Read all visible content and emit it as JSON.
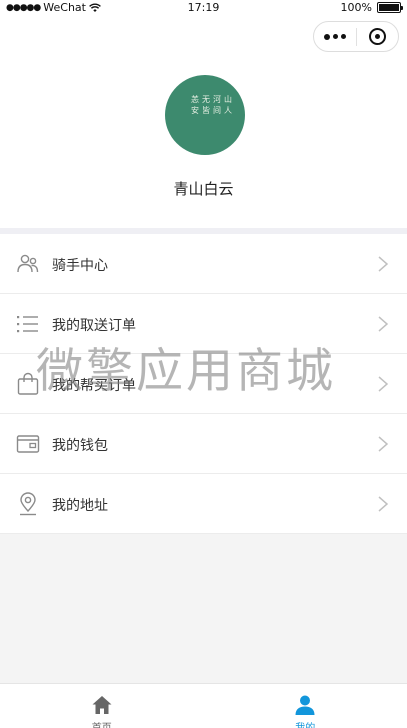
{
  "status_bar": {
    "carrier": "WeChat",
    "time": "17:19",
    "battery": "100%"
  },
  "profile": {
    "nickname": "青山白云",
    "avatar_text": [
      "山",
      "河",
      "无",
      "恙",
      "人",
      "间",
      "皆",
      "安"
    ]
  },
  "menu": {
    "items": [
      {
        "label": "骑手中心",
        "icon": "rider-icon"
      },
      {
        "label": "我的取送订单",
        "icon": "list-icon"
      },
      {
        "label": "我的帮买订单",
        "icon": "shopping-bag-icon"
      },
      {
        "label": "我的钱包",
        "icon": "wallet-icon"
      },
      {
        "label": "我的地址",
        "icon": "location-pin-icon"
      }
    ]
  },
  "watermark": "微擎应用商城",
  "tabbar": {
    "tabs": [
      {
        "label": "首页",
        "icon": "home-icon",
        "active": false
      },
      {
        "label": "我的",
        "icon": "user-icon",
        "active": true
      }
    ]
  },
  "colors": {
    "accent": "#1296db",
    "tab_inactive": "#666666",
    "avatar_bg": "#3d8a6e",
    "icon_gray": "#8a8a8a"
  }
}
